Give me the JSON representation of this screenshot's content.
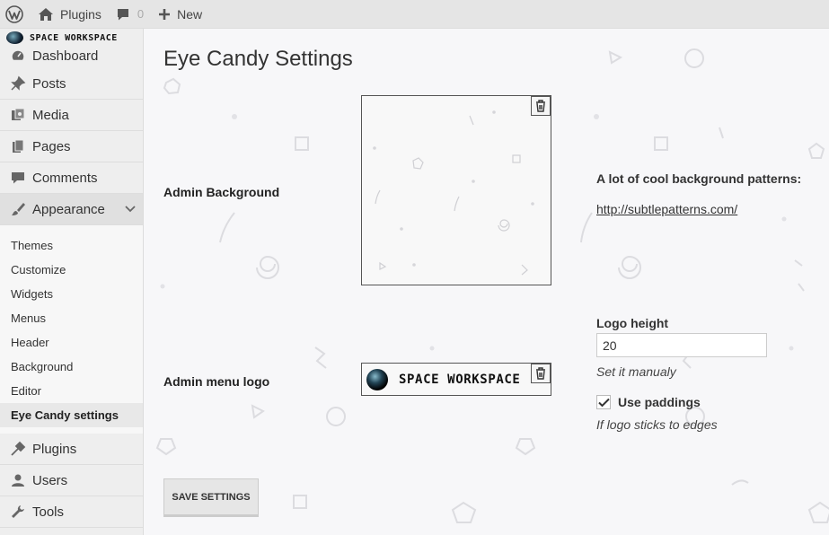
{
  "admin_bar": {
    "site_name": "Plugins",
    "comments_count": "0",
    "new_label": "New"
  },
  "sidebar": {
    "logo_text": "Space Workspace",
    "menu": [
      {
        "label": "Dashboard",
        "icon": "dashboard-icon"
      },
      {
        "label": "Posts",
        "icon": "pushpin-icon"
      },
      {
        "label": "Media",
        "icon": "media-icon"
      },
      {
        "label": "Pages",
        "icon": "pages-icon"
      },
      {
        "label": "Comments",
        "icon": "comment-icon"
      },
      {
        "label": "Appearance",
        "icon": "paintbrush-icon"
      }
    ],
    "submenu": [
      "Themes",
      "Customize",
      "Widgets",
      "Menus",
      "Header",
      "Background",
      "Editor",
      "Eye Candy settings"
    ],
    "menu_after": [
      {
        "label": "Plugins",
        "icon": "plugin-icon"
      },
      {
        "label": "Users",
        "icon": "user-icon"
      },
      {
        "label": "Tools",
        "icon": "wrench-icon"
      }
    ]
  },
  "main": {
    "title": "Eye Candy Settings",
    "admin_background_label": "Admin Background",
    "patterns_title": "A lot of cool background patterns:",
    "patterns_link": "http://subtlepatterns.com/",
    "admin_menu_logo_label": "Admin menu logo",
    "logo_preview_text": "Space Workspace",
    "logo_height_label": "Logo height",
    "logo_height_value": "20",
    "logo_height_hint": "Set it manualy",
    "use_paddings_label": "Use paddings",
    "use_paddings_checked": true,
    "use_paddings_hint": "If logo sticks to edges",
    "save_button": "Save Settings"
  },
  "colors": {
    "admin_bar_bg": "#e5e5e5",
    "sidebar_bg": "#eeeeee",
    "main_bg": "#f7f7f9"
  }
}
